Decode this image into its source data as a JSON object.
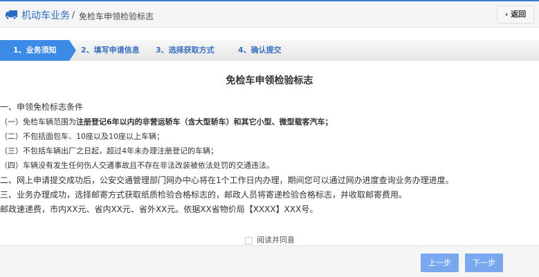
{
  "header": {
    "breadcrumb_main": "机动车业务",
    "separator": "/",
    "breadcrumb_sub": "免检车申领检验标志",
    "back_label": "返回"
  },
  "steps": [
    "1、业务须知",
    "2、填写申请信息",
    "3、选择获取方式",
    "4、确认提交"
  ],
  "content": {
    "title": "免检车申领检验标志",
    "section1": "一、申领免检标志条件",
    "item1_prefix": "（一）免检车辆范围为",
    "item1_bold": "注册登记6年以内的非营运轿车（含大型轿车）和其它小型、微型载客汽车；",
    "item2": "（二）不包括面包车、10座以及10座以上车辆；",
    "item3": "（三）不包括车辆出厂之日起，超过4年未办理注册登记的车辆；",
    "item4": "（四）车辆没有发生任何伤人交通事故且不存在非法改装被依法处罚的交通违法。",
    "section2": "二、网上申请提交成功后，公安交通管理部门网办中心将在1个工作日内办理，期间您可以通过网办进度查询业务办理进度。",
    "section3": "三、业务办理成功，选择邮寄方式获取纸质检验合格标志的，邮政人员将寄递检验合格标志，并收取邮寄费用。",
    "fee": "邮政速递费，市内XX元、省内XX元、省外XX元。依据XX省物价局【XXXX】XXX号。"
  },
  "agree_label": "阅读并同意",
  "footer": {
    "prev_label": "上一步",
    "next_label": "下一步"
  }
}
